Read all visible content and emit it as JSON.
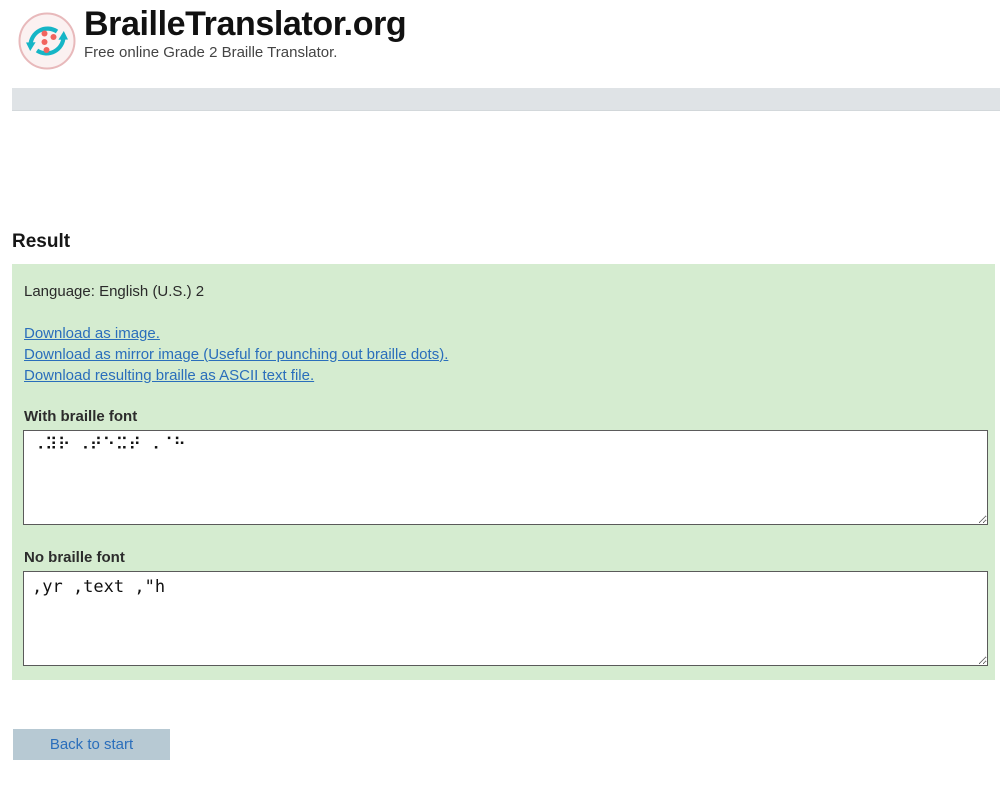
{
  "header": {
    "logo_icon": "braille-recycle-logo-icon",
    "title": "BrailleTranslator.org",
    "subtitle": "Free online Grade 2 Braille Translator.",
    "colors": {
      "logo_ring": "#e8b9bb",
      "logo_bg": "#fbf1f1",
      "logo_arrow": "#16b5c6",
      "logo_dot": "#f1645e"
    }
  },
  "navbar": {
    "background": "#dfe3e6"
  },
  "main": {
    "result_heading": "Result",
    "language_line": "Language: English (U.S.) 2",
    "panel_background": "#d5ecd0",
    "links": [
      {
        "label": "Download as image.",
        "name": "download-as-image-link"
      },
      {
        "label": "Download as mirror image (Useful for punching out braille dots).",
        "name": "download-as-mirror-image-link"
      },
      {
        "label": "Download resulting braille as ASCII text file.",
        "name": "download-ascii-text-link"
      }
    ],
    "link_color": "#2a6ebb",
    "braille_field": {
      "label": "With braille font",
      "value": "⠠⠽⠗ ⠠⠞⠑⠭⠞ ⠠⠈⠓",
      "placeholder": ""
    },
    "ascii_field": {
      "label": "No braille font",
      "value": ",yr ,text ,\"h",
      "placeholder": ""
    }
  },
  "footer": {
    "back_button_label": "Back to start",
    "back_button_background": "#b7c9d3",
    "back_button_text_color": "#2a6ebb"
  }
}
